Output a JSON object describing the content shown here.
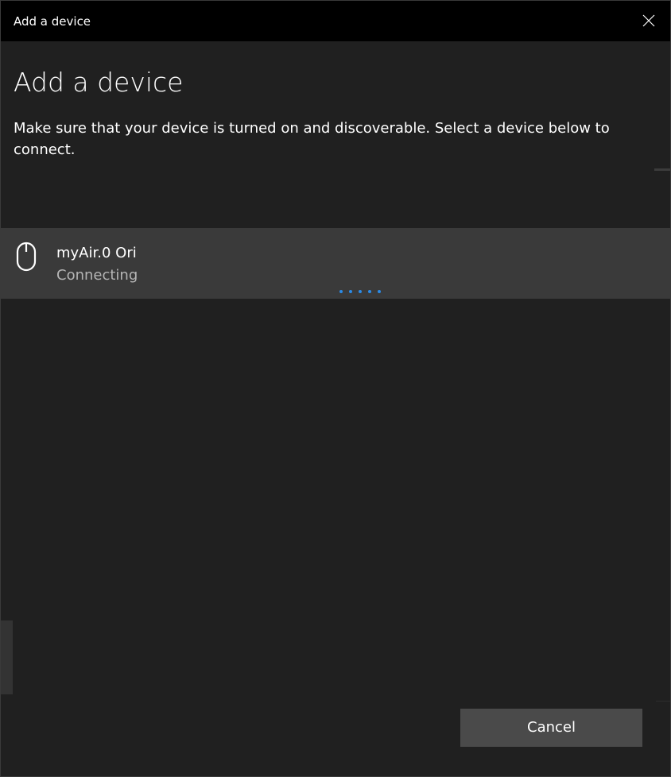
{
  "window": {
    "title": "Add a device"
  },
  "content": {
    "heading": "Add a device",
    "description": "Make sure that your device is turned on and discoverable. Select a device below to connect."
  },
  "devices": [
    {
      "name": "myAir.0 Ori",
      "status": "Connecting",
      "icon": "mouse-icon"
    }
  ],
  "footer": {
    "cancel_label": "Cancel"
  },
  "colors": {
    "background": "#202020",
    "titlebar": "#000000",
    "selected_row": "#3a3a3a",
    "accent": "#2b8be6",
    "button": "#4a4a4a",
    "secondary_text": "#b5b5b5"
  }
}
